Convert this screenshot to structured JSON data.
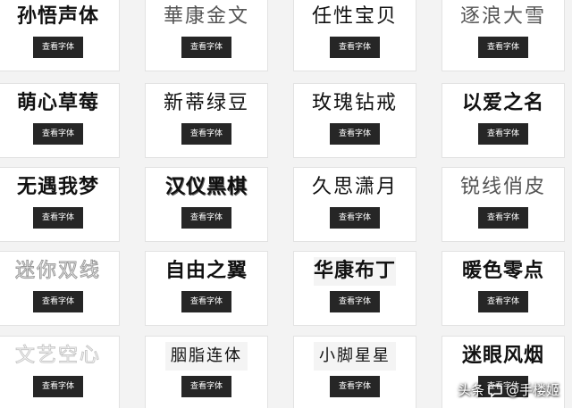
{
  "button_label": "查看字体",
  "fonts": [
    {
      "name": "孙悟声体"
    },
    {
      "name": "華康金文"
    },
    {
      "name": "任性宝贝"
    },
    {
      "name": "逐浪大雪"
    },
    {
      "name": "萌心草莓"
    },
    {
      "name": "新蒂绿豆"
    },
    {
      "name": "玫瑰钻戒"
    },
    {
      "name": "以爱之名"
    },
    {
      "name": "无遇我梦"
    },
    {
      "name": "汉仪黑棋"
    },
    {
      "name": "久思潇月"
    },
    {
      "name": "锐线俏皮"
    },
    {
      "name": "迷你双线"
    },
    {
      "name": "自由之翼"
    },
    {
      "name": "华康布丁"
    },
    {
      "name": "暖色零点"
    },
    {
      "name": "文艺空心"
    },
    {
      "name": "胭脂连体"
    },
    {
      "name": "小脚星星"
    },
    {
      "name": "迷眼风烟"
    }
  ],
  "watermark": {
    "left_text": "头条",
    "at_text": "@手楼姬",
    "icon": "chat-bubble-icon"
  }
}
